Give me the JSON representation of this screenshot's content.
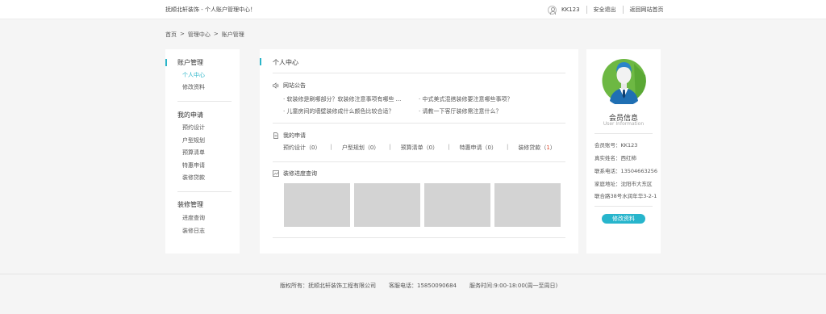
{
  "topbar": {
    "welcome": "抚顺北轩装饰 - 个人账户管理中心！",
    "username": "KK123",
    "logout": "安全退出",
    "home": "返回网站首页"
  },
  "breadcrumb": {
    "home": "首页",
    "sep1": ">",
    "center": "管理中心",
    "sep2": ">",
    "current": "账户管理"
  },
  "sidebar": {
    "groups": [
      {
        "title": "账户管理",
        "items": [
          "个人中心",
          "修改资料"
        ]
      },
      {
        "title": "我的申请",
        "items": [
          "预约设计",
          "户型规划",
          "预算清单",
          "特惠申请",
          "装修贷款"
        ]
      },
      {
        "title": "装修管理",
        "items": [
          "进度查询",
          "装修日志"
        ]
      }
    ]
  },
  "main": {
    "title": "个人中心",
    "notice": {
      "heading": "网站公告",
      "items": [
        "· 软装修是刷哪部分？软装修注意事项有哪些 ...",
        "· 中式美式混搭装修要注意哪些事项？",
        "· 儿童房间的墙壁装修成什么颜色比较合适？",
        "· 请教一下客厅装修需注意什么？"
      ]
    },
    "apply": {
      "heading": "我的申请",
      "items": [
        {
          "label": "预约设计",
          "open": "（",
          "count": "0",
          "close": "）"
        },
        {
          "label": "户型规划",
          "open": "（",
          "count": "0",
          "close": "）"
        },
        {
          "label": "预算清单",
          "open": "（",
          "count": "0",
          "close": "）"
        },
        {
          "label": "特惠申请",
          "open": "（",
          "count": "0",
          "close": "）"
        },
        {
          "label": "装修贷款",
          "open": "（",
          "count": "1",
          "close": "）"
        }
      ],
      "pipe": "|"
    },
    "progress": {
      "heading": "装修进度查询"
    }
  },
  "member": {
    "title": "会员信息",
    "subtitle": "User Information",
    "rows": [
      "会员账号：KK123",
      "真实姓名：西红柿",
      "联系电话：13504663256",
      "家庭地址：沈阳市大东区",
      "联合路38号水润年华3-2-1"
    ],
    "button": "修改资料"
  },
  "footer": {
    "copyright": "版权所有：抚顺北轩装饰工程有限公司",
    "phone": "客服电话：15850090684",
    "hours": "服务时间:9:00-18:00(周一至周日)"
  },
  "colors": {
    "accent": "#2bb5c9",
    "avatar_bg": "#6db843",
    "highlight": "#e04b2f"
  }
}
